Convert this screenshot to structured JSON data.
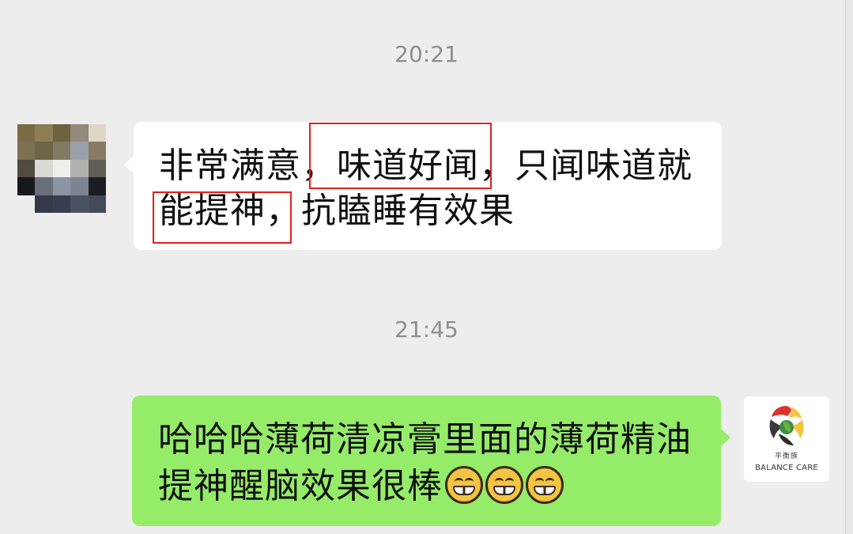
{
  "timestamps": {
    "first": "20:21",
    "second": "21:45"
  },
  "messages": [
    {
      "side": "left",
      "lines": [
        "非常满意，味道好闻，只闻味道就",
        "能提神，抗瞌睡有效果"
      ],
      "avatar": "pixelated-avatar"
    },
    {
      "side": "right",
      "lines": [
        "哈哈哈薄荷清凉膏里面的薄荷精油",
        "提神醒脑效果很棒"
      ],
      "emojis": [
        "grin-emoji",
        "grin-emoji",
        "grin-emoji"
      ],
      "avatar": "balance-care-logo"
    }
  ],
  "brand": {
    "chinese_name": "平衡族",
    "english_name": "BALANCE CARE"
  },
  "colors": {
    "background": "#ededed",
    "incoming_bubble": "#ffffff",
    "outgoing_bubble": "#95ec69",
    "timestamp_text": "#8d8d8d",
    "highlight_border": "#e0211b"
  }
}
